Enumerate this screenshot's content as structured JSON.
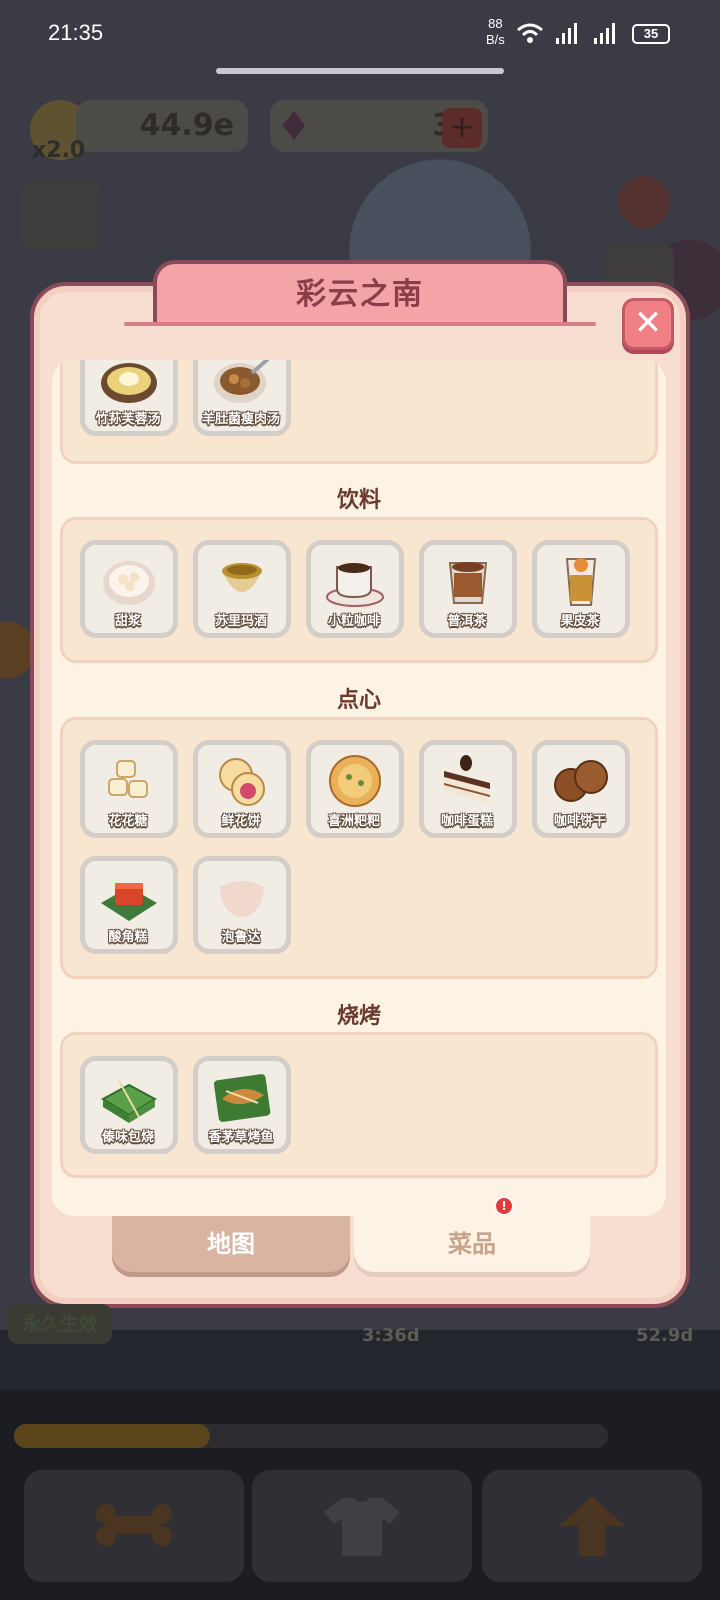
{
  "status_bar": {
    "time": "21:35",
    "net_speed_value": "88",
    "net_speed_unit": "B/s",
    "signal": "⁴ᴳ.ıll ⁵ᴳ.ıll",
    "battery": "35"
  },
  "hud": {
    "coins": "44.9e",
    "multiplier": "x2.0",
    "gems": "35",
    "plus": "+",
    "forever_label": "永久生效",
    "timer_left": "3:36d",
    "timer_right": "52.9d",
    "progress_fraction": 0.33
  },
  "modal": {
    "title": "彩云之南",
    "close_glyph": "✕",
    "sections": [
      {
        "heading": "",
        "dishes": [
          {
            "name": "竹荪芙蓉汤",
            "icon": "bamboo-fungus-soup-icon"
          },
          {
            "name": "羊肚菌瘦肉汤",
            "icon": "morel-pork-soup-icon"
          }
        ]
      },
      {
        "heading": "饮料",
        "dishes": [
          {
            "name": "甜浆",
            "icon": "sweet-drink-icon"
          },
          {
            "name": "苏里玛酒",
            "icon": "sulima-wine-icon"
          },
          {
            "name": "小粒咖啡",
            "icon": "coffee-cup-icon"
          },
          {
            "name": "普洱茶",
            "icon": "puer-tea-icon"
          },
          {
            "name": "果皮茶",
            "icon": "fruit-peel-tea-icon"
          }
        ]
      },
      {
        "heading": "点心",
        "dishes": [
          {
            "name": "花花糖",
            "icon": "flower-candy-icon"
          },
          {
            "name": "鲜花饼",
            "icon": "flower-cake-icon"
          },
          {
            "name": "喜洲粑粑",
            "icon": "xizhou-baba-icon"
          },
          {
            "name": "咖啡蛋糕",
            "icon": "coffee-cake-icon"
          },
          {
            "name": "咖啡饼干",
            "icon": "coffee-cookie-icon"
          },
          {
            "name": "酸角糕",
            "icon": "tamarind-cake-icon"
          },
          {
            "name": "泡鲁达",
            "icon": "paoluda-icon",
            "locked": true
          }
        ]
      },
      {
        "heading": "烧烤",
        "dishes": [
          {
            "name": "傣味包烧",
            "icon": "dai-leaf-grill-icon"
          },
          {
            "name": "香茅草烤鱼",
            "icon": "lemongrass-fish-icon"
          }
        ]
      }
    ]
  },
  "tabs": {
    "map": "地图",
    "dishes": "菜品",
    "badge": "!"
  },
  "colors": {
    "modal_bg": "#f8ddd1",
    "title_tab": "#f4a3a6",
    "close_button": "#f07f86",
    "section_bg": "#f9e6d0",
    "tile_border": "#d3cec8"
  }
}
